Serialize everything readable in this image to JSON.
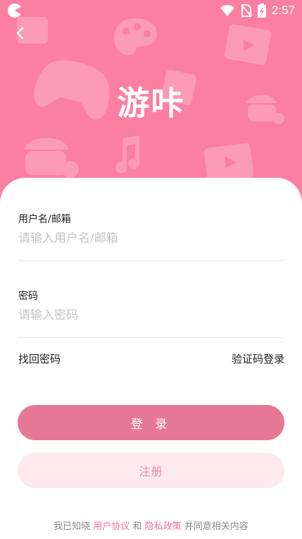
{
  "status_bar": {
    "time": "2:57",
    "icons": [
      "app-notification-icon",
      "wifi-icon",
      "no-sim-icon",
      "battery-charging-icon"
    ]
  },
  "header": {
    "back_icon": "back-arrow-icon",
    "app_title": "游咔",
    "background_color": "#fb7fa1",
    "decorative_icons": [
      "image-icon",
      "palette-icon",
      "gamepad-icon",
      "video-player-icon",
      "gift-card-icon",
      "acorn-icon",
      "music-note-icon"
    ]
  },
  "form": {
    "username": {
      "label": "用户名/邮箱",
      "placeholder": "请输入用户名/邮箱",
      "value": ""
    },
    "password": {
      "label": "密码",
      "placeholder": "请输入密码",
      "value": ""
    },
    "recover_password_link": "找回密码",
    "sms_login_link": "验证码登录"
  },
  "buttons": {
    "login": "登 录",
    "register": "注册"
  },
  "agreement": {
    "prefix": "我已知晓",
    "user_agreement": "用户协议",
    "and": "和",
    "privacy_policy": "隐私政策",
    "suffix": "并同意相关内容"
  },
  "colors": {
    "accent": "#e67895",
    "link_highlight": "#f0739a",
    "register_bg": "#fde9ee"
  }
}
